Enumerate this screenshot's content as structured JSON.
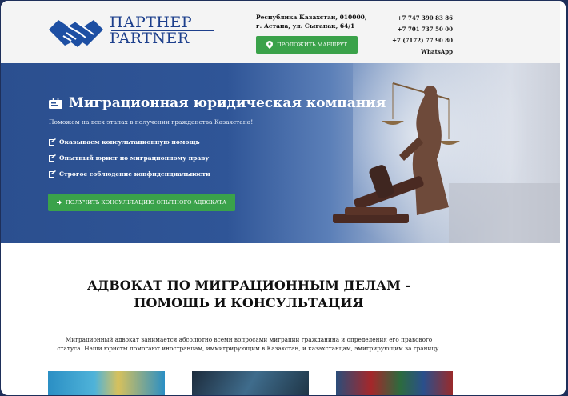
{
  "header": {
    "logo_line1": "ПАРТНЕР",
    "logo_line2": "PARTNER",
    "address_line1": "Республика Казахстан, 010000,",
    "address_line2": "г. Астана, ул. Сыганак, 64/1",
    "route_button": "ПРОЛОЖИТЬ МАРШРУТ",
    "phones": [
      "+7 747 390 83 86",
      "+7 701 737 50 00",
      "+7 (7172) 77 90 80",
      "WhatsApp"
    ]
  },
  "hero": {
    "title": "Миграционная юридическая компания",
    "subtitle": "Поможем на всех этапах в получении гражданства Казахстана!",
    "features": [
      "Оказываем консультационную помощь",
      "Опытный юрист по миграционному праву",
      "Строгое соблюдение конфиденциальности"
    ],
    "cta_button": "ПОЛУЧИТЬ КОНСУЛЬТАЦИЮ ОПЫТНОГО АДВОКАТА"
  },
  "section": {
    "title_line1": "АДВОКАТ ПО МИГРАЦИОННЫМ ДЕЛАМ -",
    "title_line2": "ПОМОЩЬ И КОНСУЛЬТАЦИЯ",
    "text_line1": "Миграционный адвокат занимается абсолютно всеми вопросами миграции гражданина и определения его правового",
    "text_line2": "статуса. Наши юристы помогают иностранцам, иммигрирующим в Казахстан, и казахстанцам, эмигрирующим за границу."
  },
  "colors": {
    "brand_blue": "#1d3f8c",
    "accent_green": "#3aa24a",
    "hero_blue": "#2f5597"
  }
}
